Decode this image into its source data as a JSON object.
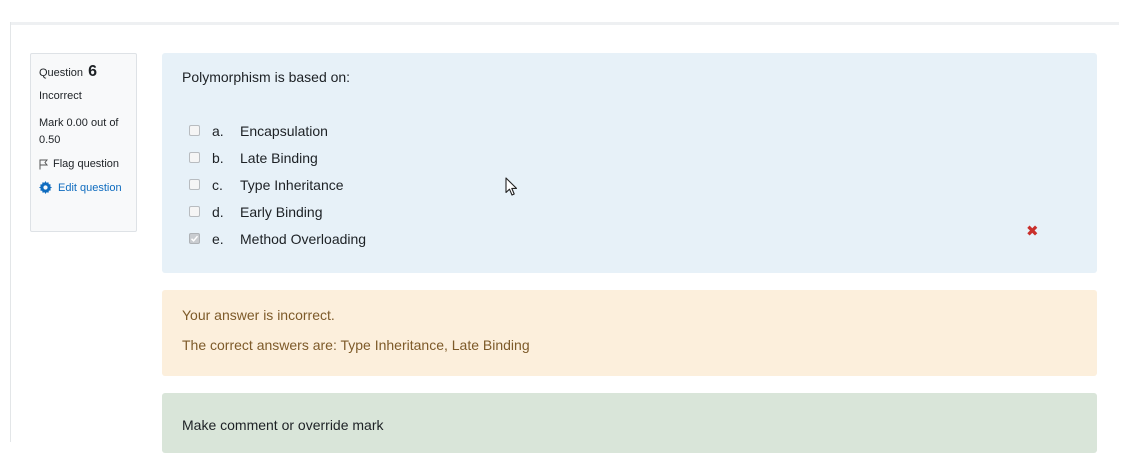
{
  "info": {
    "question_label": "Question",
    "question_number": "6",
    "state": "Incorrect",
    "grade": "Mark 0.00 out of 0.50",
    "flag_label": "Flag question",
    "edit_label": "Edit question"
  },
  "question": {
    "text": "Polymorphism is based on:",
    "options": [
      {
        "letter": "a.",
        "label": "Encapsulation",
        "checked": false
      },
      {
        "letter": "b.",
        "label": "Late Binding",
        "checked": false
      },
      {
        "letter": "c.",
        "label": "Type Inheritance",
        "checked": false
      },
      {
        "letter": "d.",
        "label": "Early Binding",
        "checked": false
      },
      {
        "letter": "e.",
        "label": "Method Overloading",
        "checked": true
      }
    ],
    "incorrect_mark": "✖"
  },
  "feedback": {
    "result": "Your answer is incorrect.",
    "correct_answers": "The correct answers are: Type Inheritance, Late Binding"
  },
  "comment": {
    "link_label": "Make comment or override mark"
  },
  "colors": {
    "formulation_bg": "#e7f1f8",
    "feedback_bg": "#fcefdc",
    "comment_bg": "#d9e5d9",
    "incorrect": "#c9302c",
    "link": "#0f6cbf"
  },
  "icons": [
    "flag-icon",
    "gear-icon",
    "incorrect-icon",
    "mouse-cursor-icon"
  ]
}
